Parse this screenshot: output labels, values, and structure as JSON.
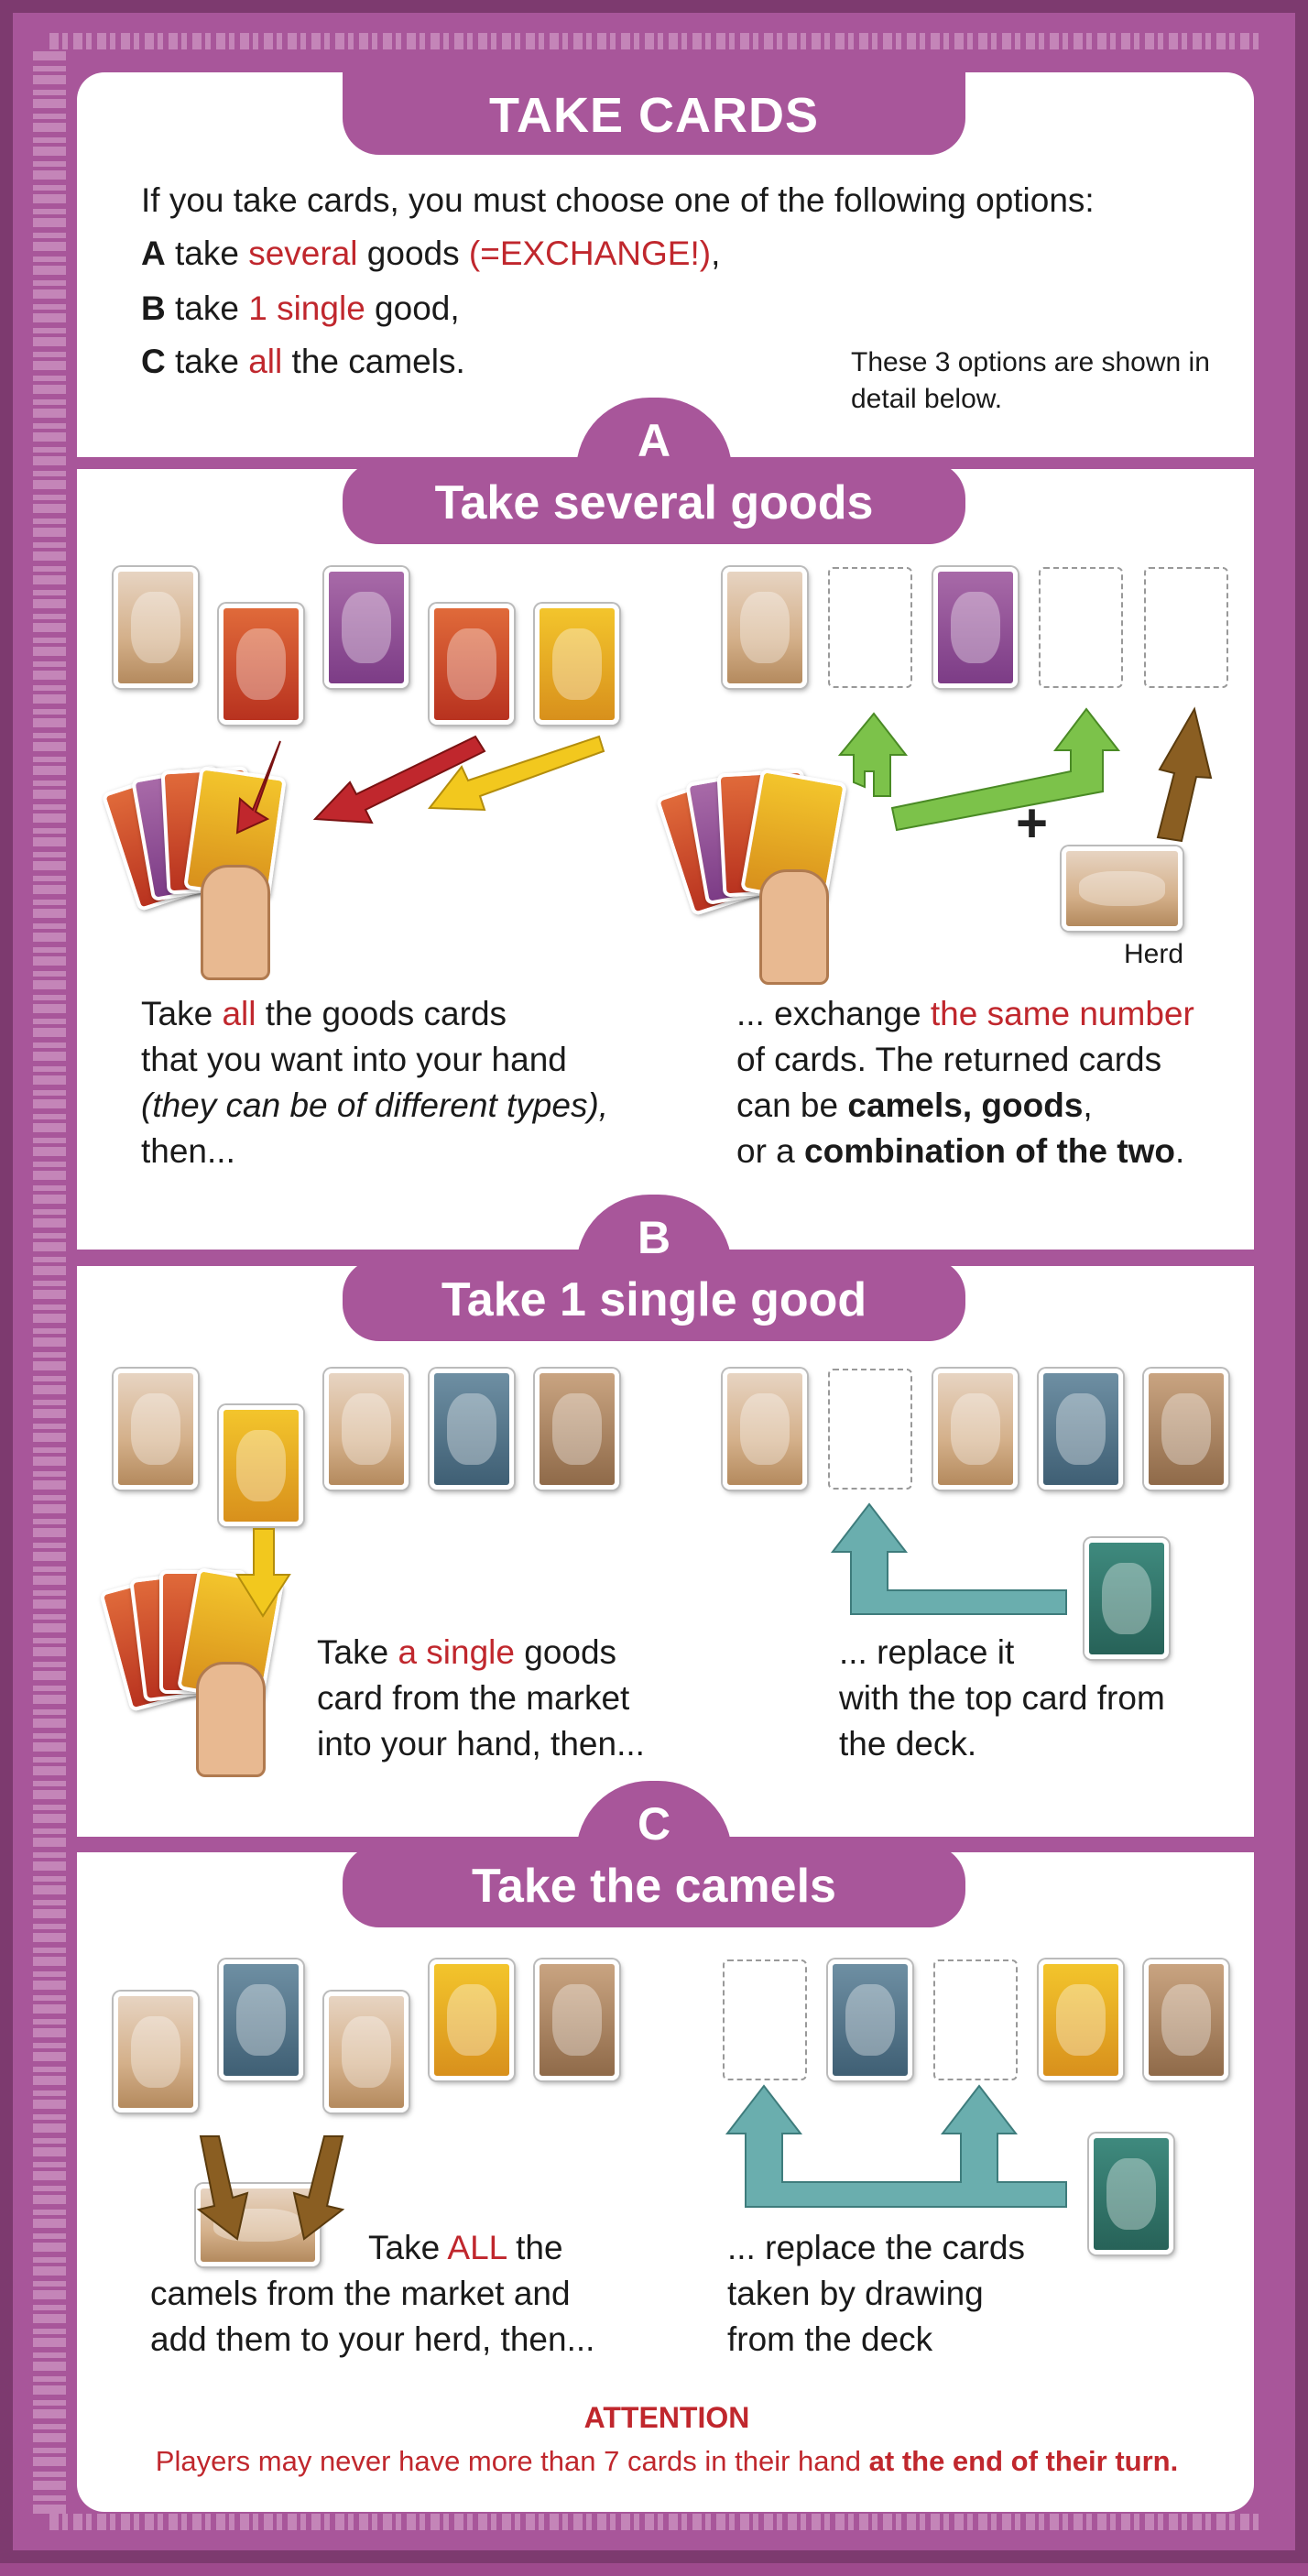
{
  "title": "TAKE CARDS",
  "intro": {
    "line1": "If you take cards, you must choose one of the following options:",
    "a_letter": "A",
    "a_pre": "take ",
    "a_red": "several",
    "a_post": " goods ",
    "a_red2": "(=EXCHANGE!)",
    "a_end": ",",
    "b_letter": "B",
    "b_pre": "take ",
    "b_red": "1 single",
    "b_post": " good,",
    "c_letter": "C",
    "c_pre": "take ",
    "c_red": "all",
    "c_post": " the camels.",
    "note": "These 3 options are shown in detail below."
  },
  "section_a": {
    "letter": "A",
    "title": "Take several goods",
    "left_pre": "Take ",
    "left_red": "all",
    "left_post": " the goods cards",
    "left_line2": "that you want into your hand",
    "left_line3": "(they can be of different types),",
    "left_line4": "then...",
    "right_pre": "... exchange ",
    "right_red": "the same number",
    "right_line2": "of cards. The returned cards",
    "right_line3_pre": "can be ",
    "right_line3_bold": "camels, goods",
    "right_line3_post": ",",
    "right_line4_pre": "or a ",
    "right_line4_bold": "combination of the two",
    "right_line4_post": ".",
    "herd_label": "Herd",
    "plus": "+"
  },
  "section_b": {
    "letter": "B",
    "title": "Take 1 single good",
    "left_pre": "Take ",
    "left_red": "a single",
    "left_post": " goods",
    "left_line2": "card from the market",
    "left_line3": "into your hand, then...",
    "right_line1": "... replace it",
    "right_line2": "with the top card from",
    "right_line3": "the deck."
  },
  "section_c": {
    "letter": "C",
    "title": "Take the camels",
    "left_pre": "Take ",
    "left_red": "ALL",
    "left_post": " the",
    "left_line2": "camels from the market and",
    "left_line3": "add them to your herd, then...",
    "right_line1": "... replace the cards",
    "right_line2": "taken by drawing",
    "right_line3": "from the deck"
  },
  "attention": {
    "heading": "ATTENTION",
    "text_pre": "Players may never have more than 7 cards in their hand ",
    "text_bold": "at the end of their turn."
  },
  "colors": {
    "frame": "#a8569a",
    "accent_red": "#c0272d",
    "arrow_red": "#c0272d",
    "arrow_yellow": "#f2c81e",
    "arrow_green": "#7cc24a",
    "arrow_brown": "#8a5e22",
    "arrow_teal": "#6aaeae"
  }
}
